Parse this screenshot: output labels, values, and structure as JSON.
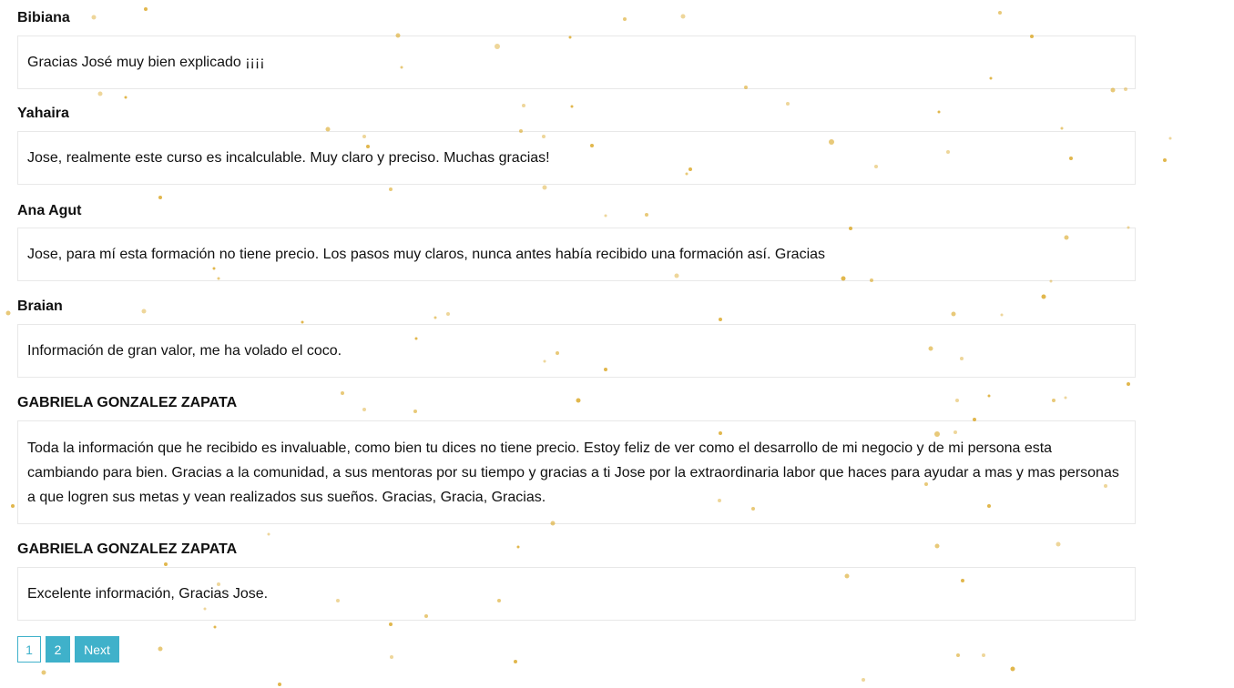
{
  "comments": [
    {
      "author": "Bibiana",
      "text": "Gracias José muy bien explicado ¡¡¡¡"
    },
    {
      "author": "Yahaira",
      "text": "Jose, realmente este curso es incalculable. Muy claro y preciso. Muchas gracias!"
    },
    {
      "author": "Ana Agut",
      "text": "Jose, para mí esta formación no tiene precio. Los pasos muy claros, nunca antes había recibido una formación así. Gracias"
    },
    {
      "author": "Braian",
      "text": "Información de gran valor, me ha volado el coco."
    },
    {
      "author": "GABRIELA GONZALEZ ZAPATA",
      "text": "Toda la información que he recibido es invaluable, como bien tu dices no tiene precio. Estoy feliz de ver como el desarrollo de mi negocio y de mi persona esta cambiando para bien. Gracias a la comunidad, a sus mentoras por su tiempo y gracias a ti Jose por la extraordinaria labor que haces para ayudar a mas y mas personas a que logren sus metas y vean realizados sus sueños. Gracias, Gracia, Gracias."
    },
    {
      "author": "GABRIELA GONZALEZ ZAPATA",
      "text": "Excelente información, Gracias Jose."
    }
  ],
  "pagination": {
    "current": "1",
    "pages": [
      "2"
    ],
    "next_label": "Next"
  },
  "colors": {
    "accent": "#3fb1ca",
    "sparkle": "#d9a520",
    "border": "#e8e8e8"
  }
}
